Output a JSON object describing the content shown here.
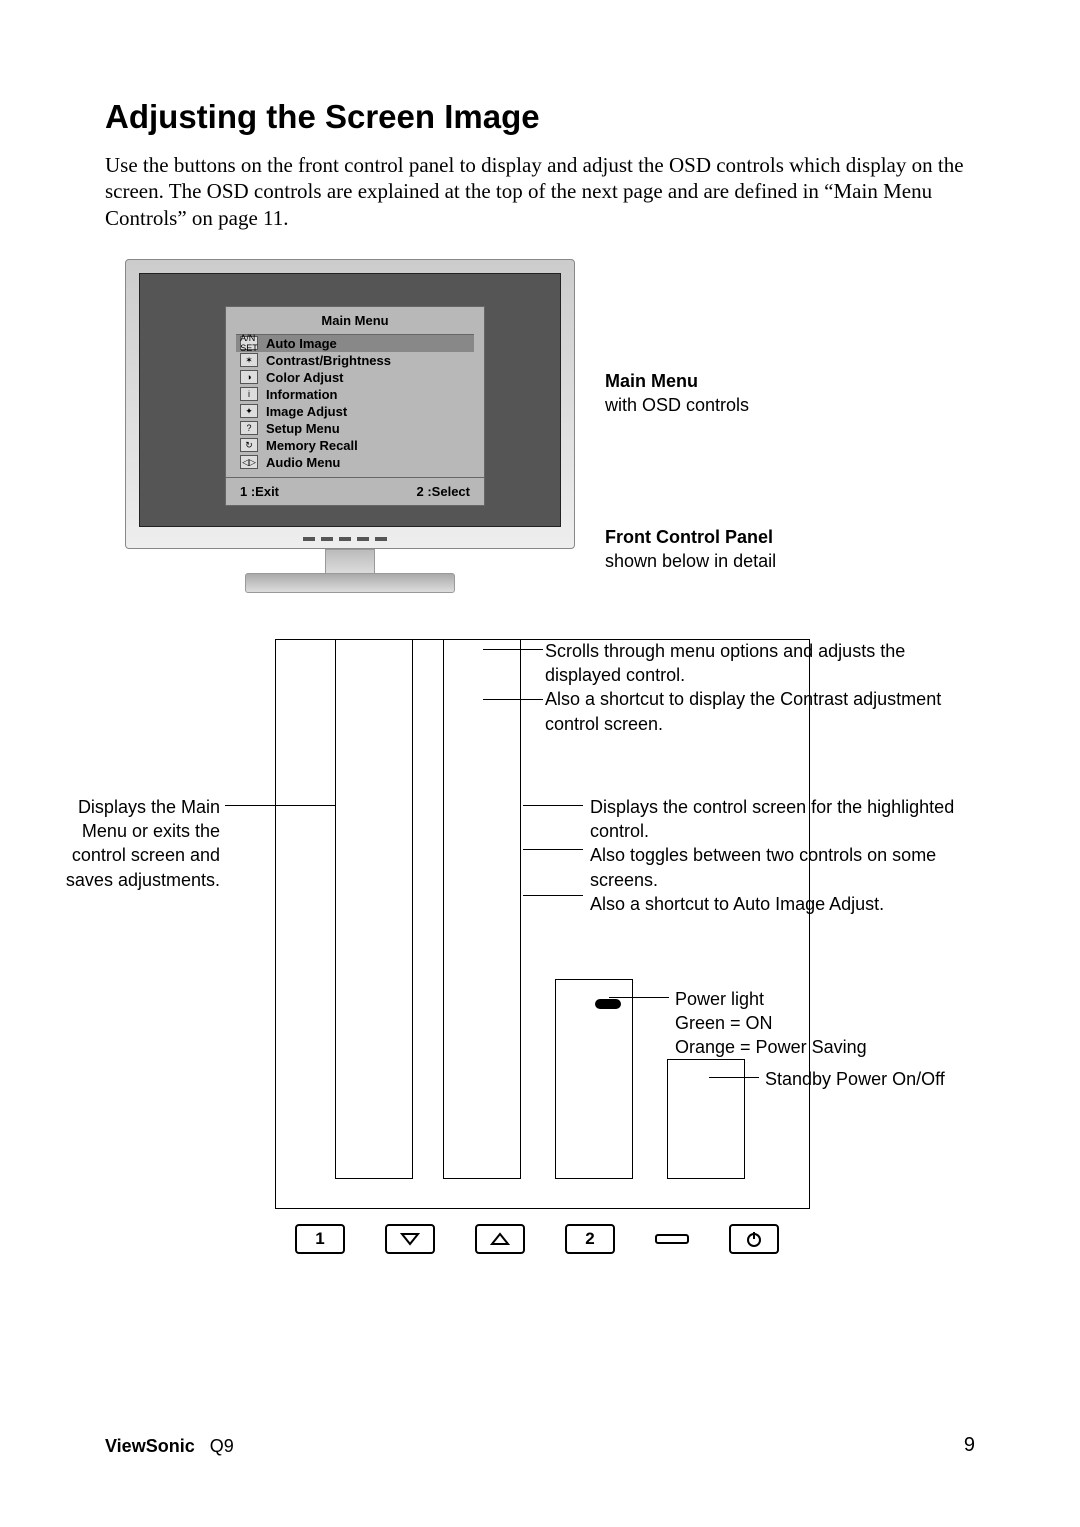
{
  "heading": "Adjusting the Screen Image",
  "intro": "Use the buttons on the front control panel to display and adjust the OSD controls which display on the screen. The OSD controls are explained at the top of the next page and are defined in “Main Menu Controls” on page 11.",
  "osd": {
    "title": "Main Menu",
    "items": [
      "Auto Image",
      "Contrast/Brightness",
      "Color Adjust",
      "Information",
      "Image Adjust",
      "Setup Menu",
      "Memory Recall",
      "Audio Menu"
    ],
    "footer_left": "1 :Exit",
    "footer_right": "2 :Select",
    "icon_labels": [
      "A/N SET",
      "✶",
      "◑",
      "i",
      "✦",
      "?",
      "↻",
      "◁▷"
    ]
  },
  "side_labels": {
    "main_menu_title": "Main Menu",
    "main_menu_sub": "with OSD controls",
    "fcp_title": "Front Control Panel",
    "fcp_sub": "shown below in detail"
  },
  "callouts": {
    "left": "Displays the Main Menu or exits the control screen and saves adjustments.",
    "top1": "Scrolls through menu options and adjusts the displayed control.",
    "top2": "Also a shortcut to display the Contrast adjustment control screen.",
    "right1": "Displays the control screen for the highlighted control.",
    "right2": "Also toggles between two controls on some screens.",
    "right3": "Also a shortcut to Auto Image Adjust.",
    "power1": "Power light",
    "power2": "Green = ON",
    "power3": "Orange = Power Saving",
    "standby": "Standby Power On/Off"
  },
  "buttons": {
    "b1": "1",
    "b2": "2"
  },
  "footer": {
    "brand": "ViewSonic",
    "model": "Q9",
    "page": "9"
  }
}
